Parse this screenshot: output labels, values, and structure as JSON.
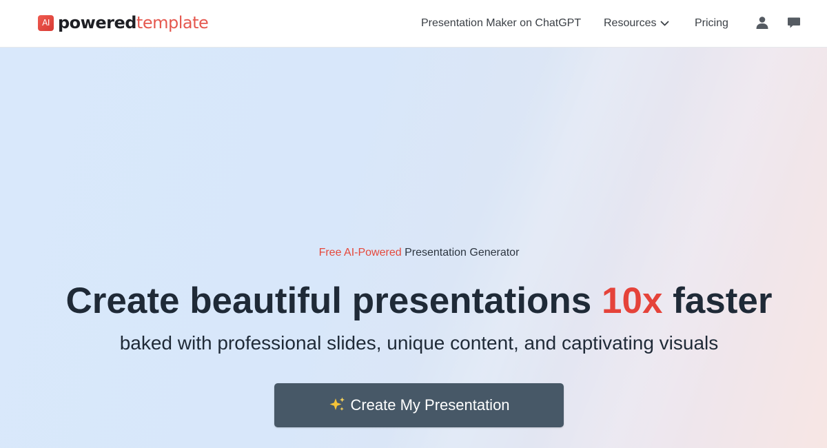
{
  "brand": {
    "logo_mark": "AI",
    "name_bold": "powered",
    "name_light": "template",
    "accent_color": "#e5483b"
  },
  "nav": {
    "links": [
      {
        "label": "Presentation Maker on ChatGPT"
      },
      {
        "label": "Resources",
        "icon": "chevron-down-icon"
      },
      {
        "label": "Pricing"
      }
    ],
    "icons": [
      "user-icon",
      "chat-icon"
    ]
  },
  "hero": {
    "eyebrow_highlight": "Free AI-Powered",
    "eyebrow_rest": " Presentation Generator",
    "headline_before": "Create beautiful presentations ",
    "headline_accent": "10x",
    "headline_after": " faster",
    "subline": "baked with professional slides, unique content, and captivating visuals",
    "cta_label": "Create My Presentation",
    "cta_icon": "sparkles-icon",
    "cta_color": "#475867"
  }
}
